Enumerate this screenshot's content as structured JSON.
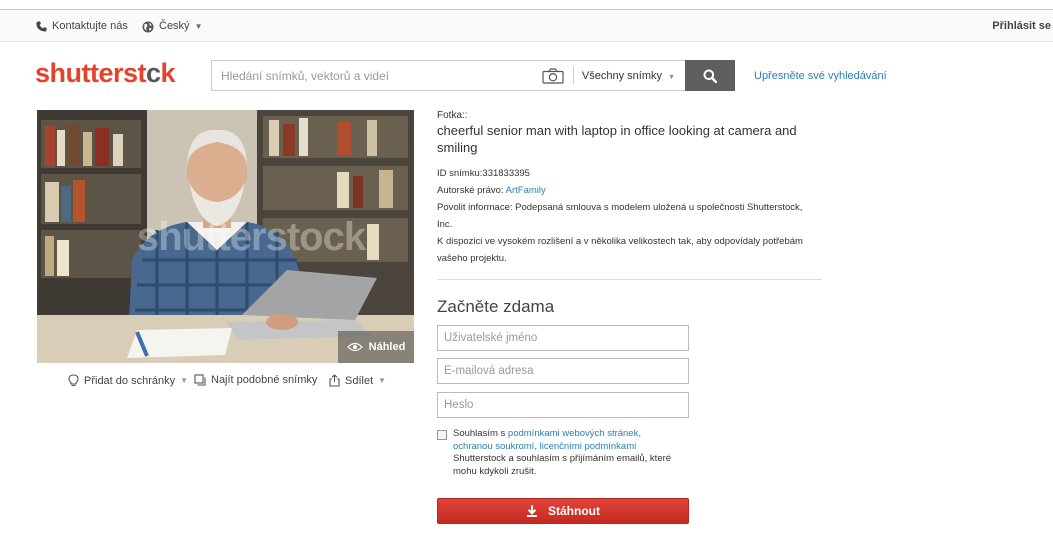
{
  "topbar": {
    "contact": "Kontaktujte nás",
    "language": "Český",
    "login": "Přihlásit se"
  },
  "header": {
    "logo_left": "shutterst",
    "logo_c": "c",
    "logo_right": "k",
    "search_placeholder": "Hledání snímků, vektorů a videí",
    "category": "Všechny snímky",
    "refine": "Upřesněte své vyhledávání"
  },
  "photo": {
    "watermark": "shutterstock",
    "preview": "Náhled",
    "actions": {
      "clipboard": "Přidat do schránky",
      "similar": "Najít podobné snímky",
      "share": "Sdílet"
    }
  },
  "info": {
    "type": "Fotka::",
    "title": "cheerful senior man with laptop in office looking at camera and smiling",
    "id_label": "ID snímku:",
    "id_value": "331833395",
    "copyright_label": "Autorské právo: ",
    "copyright_value": "ArtFamily",
    "release_text": "Povolit informace: Podepsaná smlouva s modelem uložená u společnosti Shutterstock, Inc.",
    "availability": "K dispozici ve vysokém rozlišení a v několika velikostech tak, aby odpovídaly potřebám vašeho projektu."
  },
  "form": {
    "title": "Začněte zdama",
    "username_placeholder": "Uživatelské jméno",
    "email_placeholder": "E-mailová adresa",
    "password_placeholder": "Heslo",
    "agree_prefix": "Souhlasím s ",
    "agree_link1": "podmínkami webových stránek,",
    "agree_link2": "ochranou soukromí, licenčními podmínkami",
    "agree_suffix": "Shutterstock a souhlasím s přijímáním emailů, které mohu kdykoli zrušit.",
    "download": "Stáhnout"
  },
  "colors": {
    "brand": "#e8412c",
    "link": "#2b7fb5",
    "button": "#d3362d",
    "search_button": "#5e5e5e"
  }
}
